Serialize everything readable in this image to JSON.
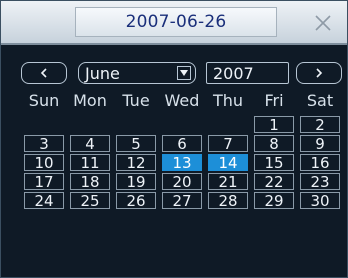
{
  "title": "2007-06-26",
  "icons": {
    "close": "close-icon",
    "prev": "chevron-left-icon",
    "next": "chevron-right-icon",
    "dropdown": "chevron-down-icon"
  },
  "nav": {
    "prev_label": "<",
    "next_label": ">"
  },
  "month": {
    "selected": "June"
  },
  "year": {
    "value": "2007"
  },
  "weekdays": [
    "Sun",
    "Mon",
    "Tue",
    "Wed",
    "Thu",
    "Fri",
    "Sat"
  ],
  "weeks": [
    [
      "",
      "",
      "",
      "",
      "",
      "1",
      "2"
    ],
    [
      "3",
      "4",
      "5",
      "6",
      "7",
      "8",
      "9"
    ],
    [
      "10",
      "11",
      "12",
      "13",
      "14",
      "15",
      "16"
    ],
    [
      "17",
      "18",
      "19",
      "20",
      "21",
      "22",
      "23"
    ],
    [
      "24",
      "25",
      "26",
      "27",
      "28",
      "29",
      "30"
    ]
  ],
  "highlighted_days": [
    "13",
    "14"
  ],
  "colors": {
    "highlight": "#1d8fd8",
    "background": "#0f1a26",
    "title_text": "#1a2f7a"
  }
}
